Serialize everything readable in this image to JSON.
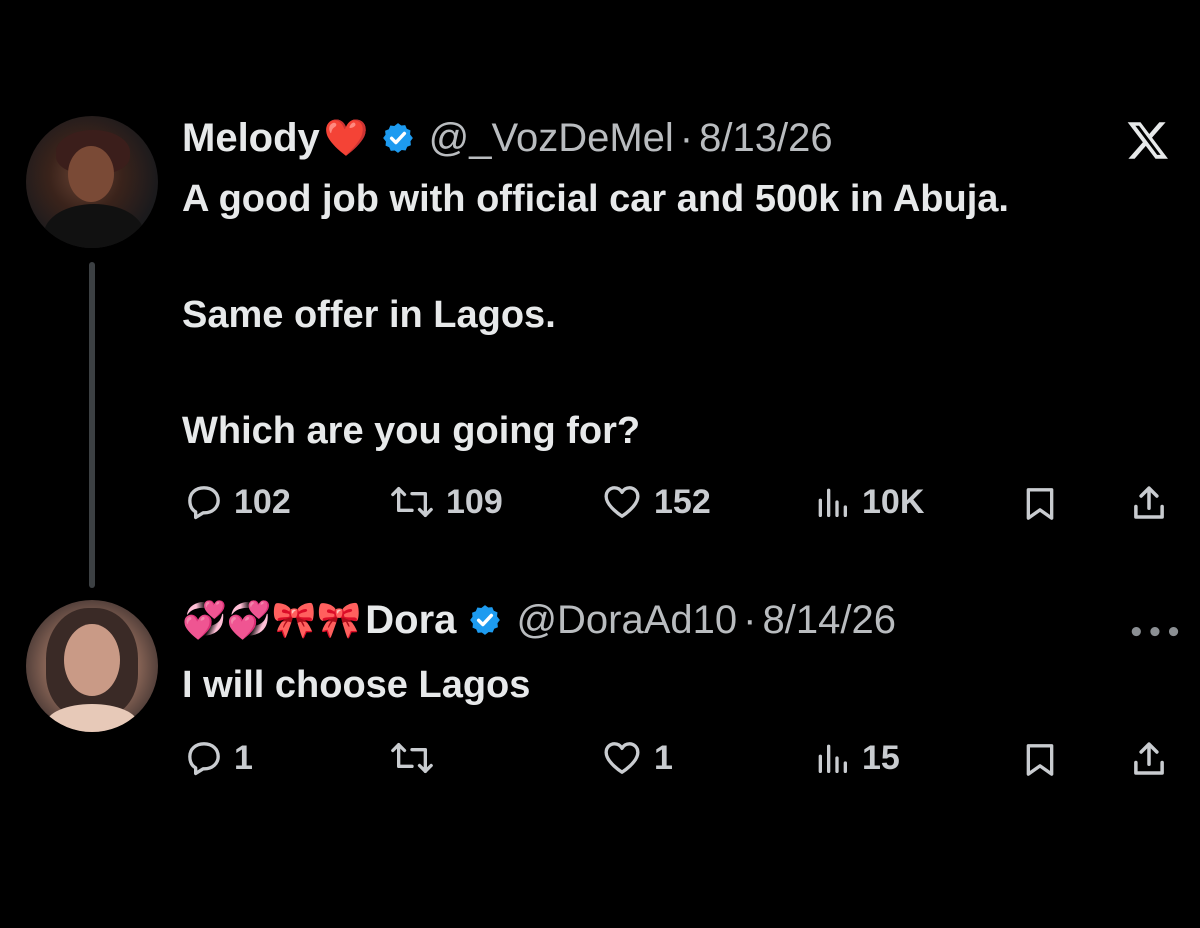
{
  "tweet": {
    "name": "Melody",
    "name_emoji": "❤️",
    "handle": "@_VozDeMel",
    "separator": "·",
    "date": "8/13/26",
    "text_lines": [
      "A good job with official car and 500k in Abuja.",
      "Same offer in Lagos.",
      "Which are you going for?"
    ],
    "replies": "102",
    "reposts": "109",
    "likes": "152",
    "views": "10K"
  },
  "reply": {
    "name_emojis": "💞💞🎀🎀",
    "name": "Dora",
    "handle": "@DoraAd10",
    "separator": "·",
    "date": "8/14/26",
    "text_lines": [
      "I will choose Lagos"
    ],
    "replies": "1",
    "reposts": "",
    "likes": "1",
    "views": "15"
  },
  "colors": {
    "background": "#000000",
    "text": "#e7e9ea",
    "muted": "#b9bcbf",
    "verified": "#1d9bf0",
    "thread_line": "#3c4043"
  },
  "icons": {
    "platform": "x-logo-icon",
    "verified": "verified-badge-icon",
    "reply": "reply-icon",
    "repost": "repost-icon",
    "like": "heart-icon",
    "views": "views-icon",
    "bookmark": "bookmark-icon",
    "share": "share-icon",
    "more": "more-icon"
  }
}
